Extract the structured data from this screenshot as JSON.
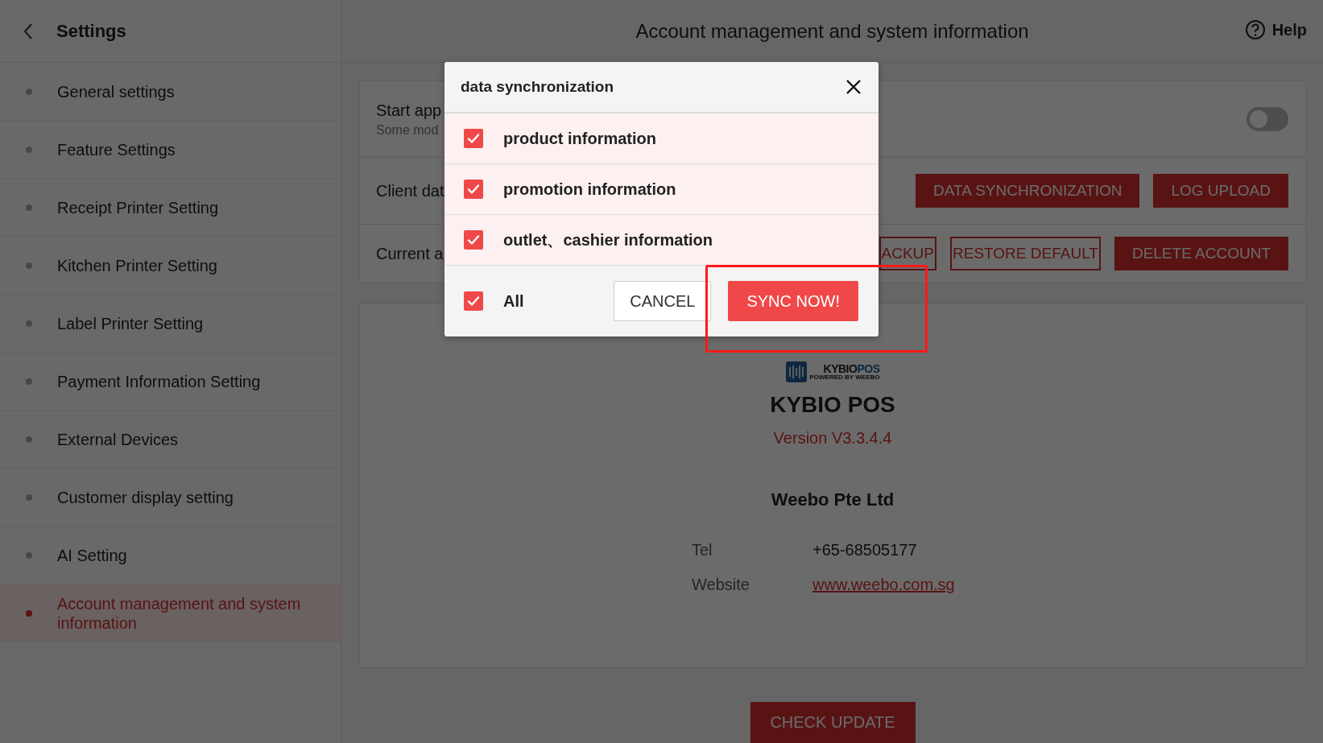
{
  "sidebar": {
    "title": "Settings",
    "items": [
      {
        "label": "General settings",
        "selected": false
      },
      {
        "label": "Feature Settings",
        "selected": false
      },
      {
        "label": "Receipt Printer Setting",
        "selected": false
      },
      {
        "label": "Kitchen Printer Setting",
        "selected": false
      },
      {
        "label": "Label Printer Setting",
        "selected": false
      },
      {
        "label": "Payment Information Setting",
        "selected": false
      },
      {
        "label": "External Devices",
        "selected": false
      },
      {
        "label": "Customer display setting",
        "selected": false
      },
      {
        "label": "AI Setting",
        "selected": false
      },
      {
        "label": "Account management and system information",
        "selected": true
      }
    ]
  },
  "header": {
    "title": "Account management and system information",
    "help": "Help"
  },
  "settings_card": {
    "rows": [
      {
        "label": "Start app",
        "sublabel": "Some mod",
        "toggle": {
          "on": false
        }
      },
      {
        "label": "Client dat",
        "buttons": [
          {
            "label": "DATA SYNCHRONIZATION",
            "kind": "filled"
          },
          {
            "label": "LOG UPLOAD",
            "kind": "filled"
          }
        ]
      },
      {
        "label": "Current a",
        "buttons": [
          {
            "label": "ACKUP",
            "kind": "outline"
          },
          {
            "label": "RESTORE DEFAULT",
            "kind": "outline"
          },
          {
            "label": "DELETE ACCOUNT",
            "kind": "filled"
          }
        ]
      }
    ]
  },
  "about_card": {
    "logo": {
      "brand": "KYBIO",
      "brand_accent": "POS",
      "tagline": "POWERED BY WEEBO"
    },
    "app_name": "KYBIO POS",
    "version": "Version V3.3.4.4",
    "company": "Weebo Pte Ltd",
    "contacts": [
      {
        "label": "Tel",
        "value": "+65-68505177",
        "kind": "text"
      },
      {
        "label": "Website",
        "value": "www.weebo.com.sg",
        "kind": "link"
      }
    ]
  },
  "check_update_button": "CHECK UPDATE",
  "dialog": {
    "title": "data synchronization",
    "options": [
      {
        "label": "product information",
        "checked": true
      },
      {
        "label": "promotion information",
        "checked": true
      },
      {
        "label": "outlet、cashier information",
        "checked": true
      }
    ],
    "all": {
      "label": "All",
      "checked": true
    },
    "buttons": [
      {
        "label": "CANCEL",
        "kind": "outline"
      },
      {
        "label": "SYNC NOW!",
        "kind": "primary"
      }
    ]
  }
}
